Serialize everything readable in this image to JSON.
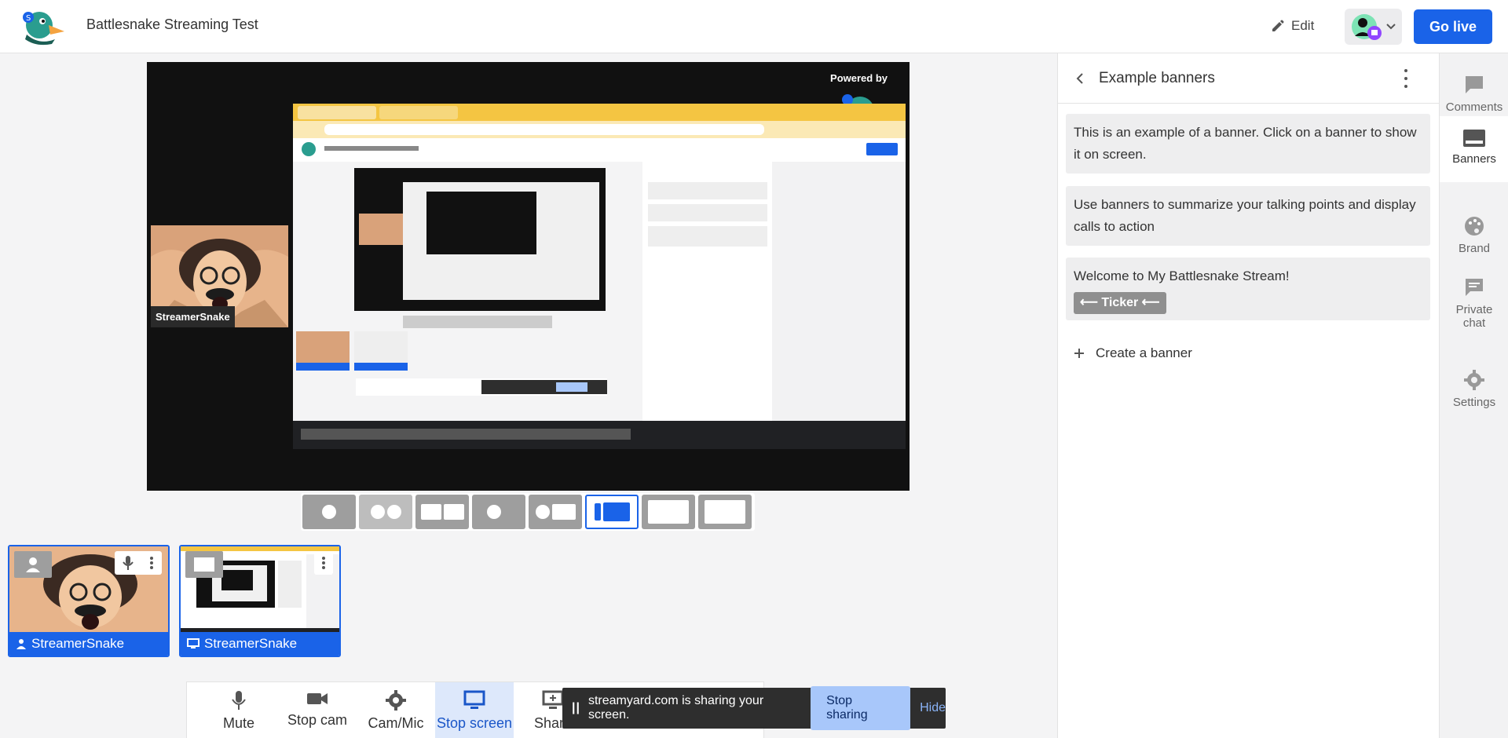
{
  "header": {
    "title": "Battlesnake Streaming Test",
    "edit_label": "Edit",
    "go_live_label": "Go live"
  },
  "stage": {
    "powered_by": "Powered by",
    "cam_label": "StreamerSnake"
  },
  "thumbnails": [
    {
      "label": "StreamerSnake",
      "icon": "person-icon"
    },
    {
      "label": "StreamerSnake",
      "icon": "monitor-icon"
    }
  ],
  "controls": {
    "mute": "Mute",
    "stop_cam": "Stop cam",
    "cam_mic": "Cam/Mic",
    "stop_screen": "Stop screen",
    "share": "Share"
  },
  "share_bar": {
    "pause": "||",
    "message": "streamyard.com is sharing your screen.",
    "stop": "Stop sharing",
    "hide": "Hide"
  },
  "panel": {
    "title": "Example banners",
    "banners": [
      {
        "text": "This is an example of a banner. Click on a banner to show it on screen."
      },
      {
        "text": "Use banners to summarize your talking points and display calls to action"
      },
      {
        "text": "Welcome to My Battlesnake Stream!",
        "badge": "⟵ Ticker ⟵"
      }
    ],
    "create": "Create a banner"
  },
  "rail": [
    {
      "label": "Comments",
      "icon": "comment-icon"
    },
    {
      "label": "Banners",
      "icon": "banner-icon"
    },
    {
      "label": "Brand",
      "icon": "palette-icon"
    },
    {
      "label": "Private chat",
      "icon": "chat-icon"
    },
    {
      "label": "Settings",
      "icon": "gear-icon"
    }
  ],
  "colors": {
    "accent": "#1a63e8",
    "stage_bg": "#111111",
    "rail_bg": "#f2f2f3"
  }
}
